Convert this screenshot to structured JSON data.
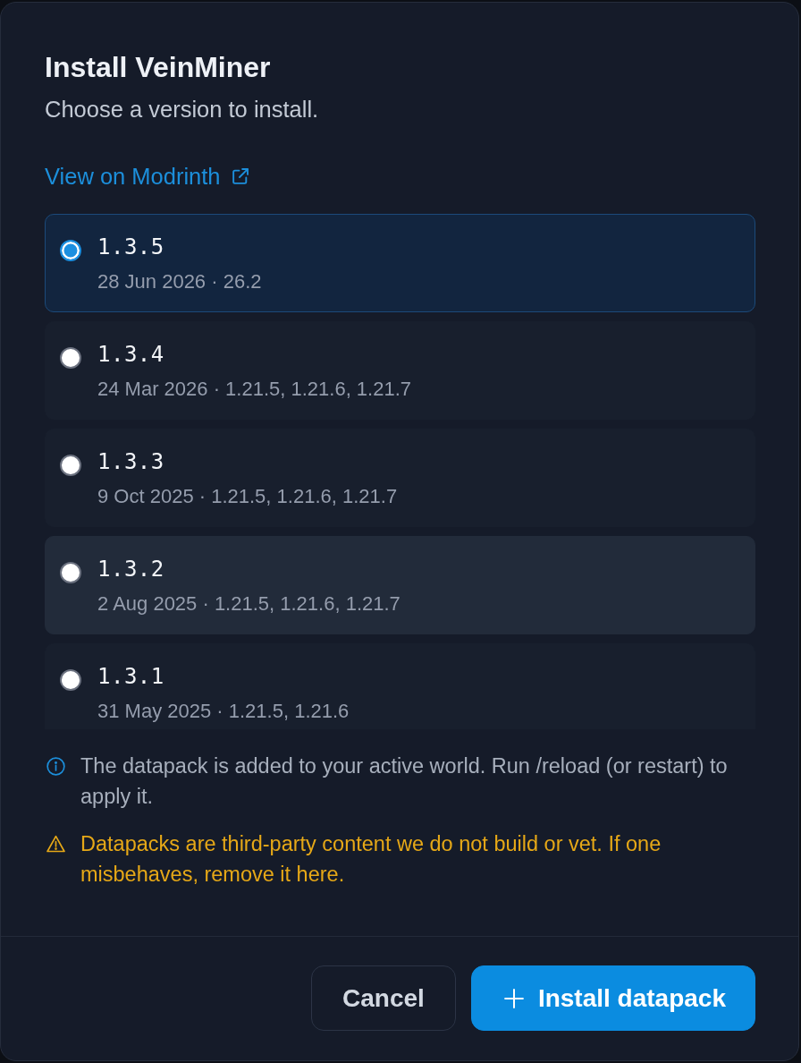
{
  "dialog": {
    "title": "Install VeinMiner",
    "subtitle": "Choose a version to install.",
    "link": "View on Modrinth"
  },
  "versions": [
    {
      "version": "1.3.5",
      "details": "28 Jun 2026 · 26.2",
      "selected": true,
      "hovered": false
    },
    {
      "version": "1.3.4",
      "details": "24 Mar 2026 · 1.21.5, 1.21.6, 1.21.7",
      "selected": false,
      "hovered": false
    },
    {
      "version": "1.3.3",
      "details": "9 Oct 2025 · 1.21.5, 1.21.6, 1.21.7",
      "selected": false,
      "hovered": false
    },
    {
      "version": "1.3.2",
      "details": "2 Aug 2025 · 1.21.5, 1.21.6, 1.21.7",
      "selected": false,
      "hovered": true
    },
    {
      "version": "1.3.1",
      "details": "31 May 2025 · 1.21.5, 1.21.6",
      "selected": false,
      "hovered": false
    }
  ],
  "notes": [
    {
      "kind": "info",
      "text": "The datapack is added to your active world. Run /reload (or restart) to apply it."
    },
    {
      "kind": "warning",
      "text": "Datapacks are third-party content we do not build or vet. If one misbehaves, remove it here."
    }
  ],
  "buttons": [
    {
      "kind": "secondary",
      "label": "Cancel"
    },
    {
      "kind": "primary",
      "label": "Install datapack"
    }
  ]
}
